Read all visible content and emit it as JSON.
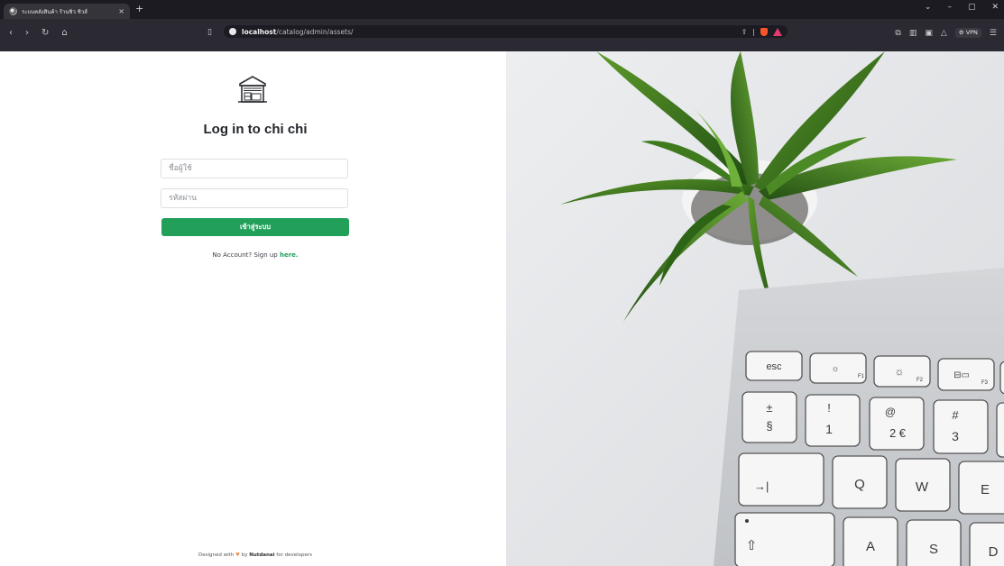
{
  "browser": {
    "tab_title": "ระบบคลังสินค้า ร้านชิว ชิวส์",
    "tab_close": "×",
    "new_tab": "+",
    "url_host": "localhost",
    "url_path": "/catalog/admin/assets/",
    "vpn_label": "VPN",
    "icons": [
      "back-icon",
      "forward-icon",
      "reload-icon",
      "home-icon",
      "bookmark-icon",
      "lock-icon",
      "share-icon",
      "brave-shield-icon",
      "brave-rewards-icon",
      "extensions-icon",
      "sidebar-icon",
      "wallet-icon",
      "leo-icon",
      "menu-icon"
    ]
  },
  "login": {
    "title": "Log in to chi chi",
    "username_placeholder": "ชื่อผู้ใช้",
    "password_placeholder": "รหัสผ่าน",
    "submit_label": "เข้าสู่ระบบ",
    "signup_text": "No Account? Sign up",
    "signup_link": "here."
  },
  "footer": {
    "prefix": "Designed with",
    "by": "by",
    "author": "Nutdanai",
    "suffix": "for developers"
  },
  "keyboard": {
    "keys": [
      "esc",
      "F1",
      "F2",
      "F3",
      "±",
      "§",
      "!",
      "1",
      "@",
      "2 €",
      "#",
      "3",
      "→|",
      "Q",
      "W",
      "E",
      "A",
      "S",
      "D"
    ]
  },
  "colors": {
    "accent": "#22a05a",
    "chrome_dark": "#1c1b22",
    "toolbar": "#2b2a33"
  }
}
